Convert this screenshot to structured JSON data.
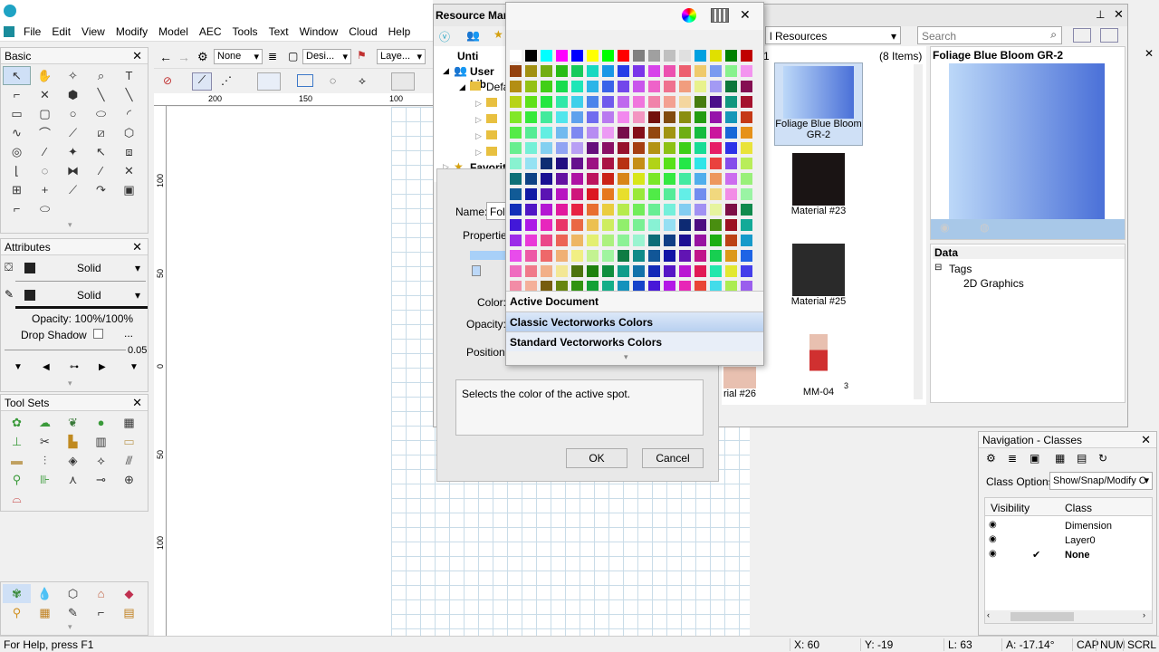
{
  "app": {
    "menus": [
      "File",
      "Edit",
      "View",
      "Modify",
      "Model",
      "AEC",
      "Tools",
      "Text",
      "Window",
      "Cloud",
      "Help"
    ]
  },
  "view_bar": {
    "class_value": "None",
    "design_layer": "Desi...",
    "layer": "Laye..."
  },
  "ruler": {
    "h_ticks": [
      "200",
      "150",
      "100"
    ],
    "v_ticks": [
      "100",
      "50",
      "0",
      "50",
      "100"
    ]
  },
  "basic_palette": {
    "title": "Basic"
  },
  "attributes": {
    "title": "Attributes",
    "fill_style": "Solid",
    "pen_style": "Solid",
    "opacity": "Opacity: 100%/100%",
    "drop_shadow": "Drop Shadow",
    "drop_shadow_more": "...",
    "line_weight": "0.05"
  },
  "toolsets": {
    "title": "Tool Sets"
  },
  "resource_manager": {
    "title": "Resource Man",
    "file_label": "Unti",
    "user_lib": "User Lib",
    "default": "Defa",
    "favorites": "Favorite",
    "library_select": "l Resources",
    "search_placeholder": "Search",
    "item_count": "(8 Items)",
    "items_partial": "1",
    "items": [
      {
        "name": "Foliage Blue Bloom GR-2"
      },
      {
        "name": "Material #23"
      },
      {
        "name": "Material #25"
      },
      {
        "name": "rial #26"
      },
      {
        "name": "MM-04"
      }
    ],
    "badge": "3",
    "preview_title": "Foliage Blue Bloom GR-2",
    "data_title": "Data",
    "tags_label": "Tags",
    "tag_value": "2D Graphics"
  },
  "dialog": {
    "name_label": "Name:",
    "name_value": "Folia",
    "properties_label": "Properties",
    "color_label": "Color:",
    "opacity_label": "Opacity:",
    "position_label": "Position:",
    "help_text": "Selects the color of the active spot.",
    "ok": "OK",
    "cancel": "Cancel"
  },
  "color_popup": {
    "sections": [
      "Active Document",
      "Classic Vectorworks Colors",
      "Standard Vectorworks Colors"
    ]
  },
  "navigation": {
    "title": "Navigation - Classes",
    "class_options_label": "Class Options:",
    "class_options_value": "Show/Snap/Modify C",
    "col_visibility": "Visibility",
    "col_class": "Class",
    "rows": [
      {
        "name": "Dimension",
        "active": false
      },
      {
        "name": "Layer0",
        "active": false
      },
      {
        "name": "None",
        "active": true
      }
    ],
    "check": "✔"
  },
  "status": {
    "help": "For Help, press F1",
    "x": "X: 60",
    "y": "Y: -19",
    "l": "L: 63",
    "a": "A: -17.14°",
    "cap": "CAP",
    "num": "NUM",
    "scrl": "SCRL"
  },
  "colors": {
    "accent": "#3c78c8",
    "grid": "#c9dce8"
  }
}
